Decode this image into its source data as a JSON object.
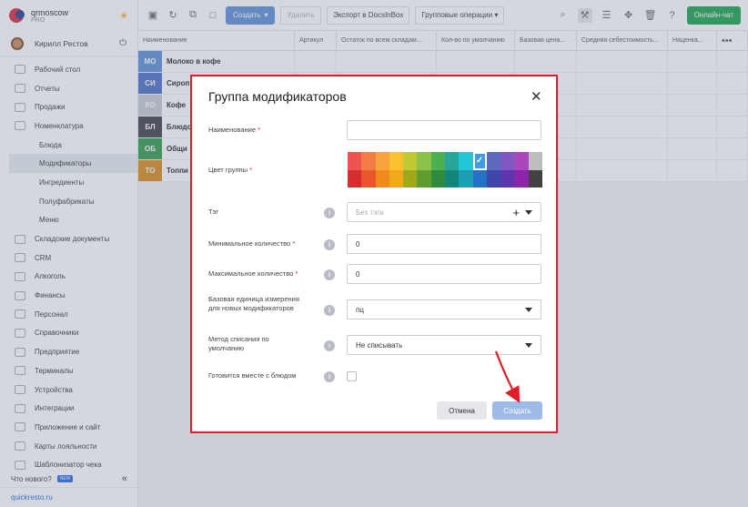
{
  "brand": {
    "name": "qrmoscow",
    "plan": "PRO"
  },
  "user": {
    "name": "Кирилл Рестов"
  },
  "nav": [
    {
      "label": "Рабочий стол",
      "level": 0,
      "icon": "dashboard-icon"
    },
    {
      "label": "Отчеты",
      "level": 0,
      "icon": "reports-icon"
    },
    {
      "label": "Продажи",
      "level": 0,
      "icon": "sales-icon"
    },
    {
      "label": "Номенклатура",
      "level": 0,
      "icon": "nomenclature-icon"
    },
    {
      "label": "Блюда",
      "level": 1
    },
    {
      "label": "Модификаторы",
      "level": 1,
      "active": true
    },
    {
      "label": "Ингредиенты",
      "level": 1
    },
    {
      "label": "Полуфабрикаты",
      "level": 1
    },
    {
      "label": "Меню",
      "level": 1
    },
    {
      "label": "Складские документы",
      "level": 0,
      "icon": "warehouse-icon"
    },
    {
      "label": "CRM",
      "level": 0,
      "icon": "crm-icon"
    },
    {
      "label": "Алкоголь",
      "level": 0,
      "icon": "alcohol-icon"
    },
    {
      "label": "Финансы",
      "level": 0,
      "icon": "finance-icon"
    },
    {
      "label": "Персонал",
      "level": 0,
      "icon": "staff-icon"
    },
    {
      "label": "Справочники",
      "level": 0,
      "icon": "directory-icon"
    },
    {
      "label": "Предприятие",
      "level": 0,
      "icon": "enterprise-icon"
    },
    {
      "label": "Терминалы",
      "level": 0,
      "icon": "terminal-icon"
    },
    {
      "label": "Устройства",
      "level": 0,
      "icon": "device-icon"
    },
    {
      "label": "Интеграции",
      "level": 0,
      "icon": "integration-icon"
    },
    {
      "label": "Приложение и сайт",
      "level": 0,
      "icon": "app-icon"
    },
    {
      "label": "Карты лояльности",
      "level": 0,
      "icon": "loyalty-card-icon"
    },
    {
      "label": "Шаблонизатор чека",
      "level": 0,
      "icon": "receipt-template-icon"
    }
  ],
  "sidebar_footer": {
    "whats_new": "Что нового?",
    "new_badge": "NEW",
    "site": "quickresto.ru"
  },
  "toolbar": {
    "create": "Создать",
    "delete": "Удалить",
    "export": "Экспорт в DocsInBox",
    "group_ops": "Групповые операции",
    "chat": "Онлайн-чат"
  },
  "table": {
    "columns": [
      "Наименование",
      "Артикул",
      "Остаток по всем складам...",
      "Кол-во по умолчанию",
      "Базовая цена...",
      "Средняя себестоимость...",
      "Наценка..."
    ],
    "rows": [
      {
        "tag": "МО",
        "name": "Молоко в кофе",
        "color": "#5b8ed6"
      },
      {
        "tag": "СИ",
        "name": "Сироп",
        "color": "#4a6fc7"
      },
      {
        "tag": "КО",
        "name": "Кофе",
        "color": "#c8ccd2"
      },
      {
        "tag": "БЛ",
        "name": "Блюдо",
        "color": "#3b3f46"
      },
      {
        "tag": "ОБ",
        "name": "Общи",
        "color": "#2f9a4b"
      },
      {
        "tag": "ТО",
        "name": "Топпи",
        "color": "#d98a1c"
      }
    ]
  },
  "modal": {
    "title": "Группа модификаторов",
    "name_label": "Наименование",
    "name_value": "",
    "color_label": "Цвет группы",
    "tag_label": "Тэг",
    "tag_placeholder": "Без тэга",
    "min_label": "Минимальное количество",
    "min_value": "0",
    "max_label": "Максимальное количество",
    "max_value": "0",
    "unit_label": "Базовая единица измерения для новых модификаторов",
    "unit_value": "пц",
    "method_label": "Метод списания по умолчанию",
    "method_value": "Не списывать",
    "cook_label": "Готовится вместе с блюдом",
    "cancel": "Отмена",
    "submit": "Создать",
    "palette_top": [
      "#ef5350",
      "#f27c43",
      "#f5a33a",
      "#fbc02d",
      "#c0ca33",
      "#8bc34a",
      "#4caf50",
      "#26a69a",
      "#26c6da",
      "#3f9be8",
      "#5c6bc0",
      "#7e57c2",
      "#ab47bc",
      "#bdbdbd"
    ],
    "palette_bottom": [
      "#d32f2f",
      "#e8562c",
      "#ef8a1e",
      "#f2a81d",
      "#9eaa1c",
      "#5d9e2f",
      "#2e8b3e",
      "#13857a",
      "#1c9fb3",
      "#2472c8",
      "#3e48a8",
      "#5e35b1",
      "#8e24aa",
      "#424242"
    ],
    "palette_selected": 9
  }
}
